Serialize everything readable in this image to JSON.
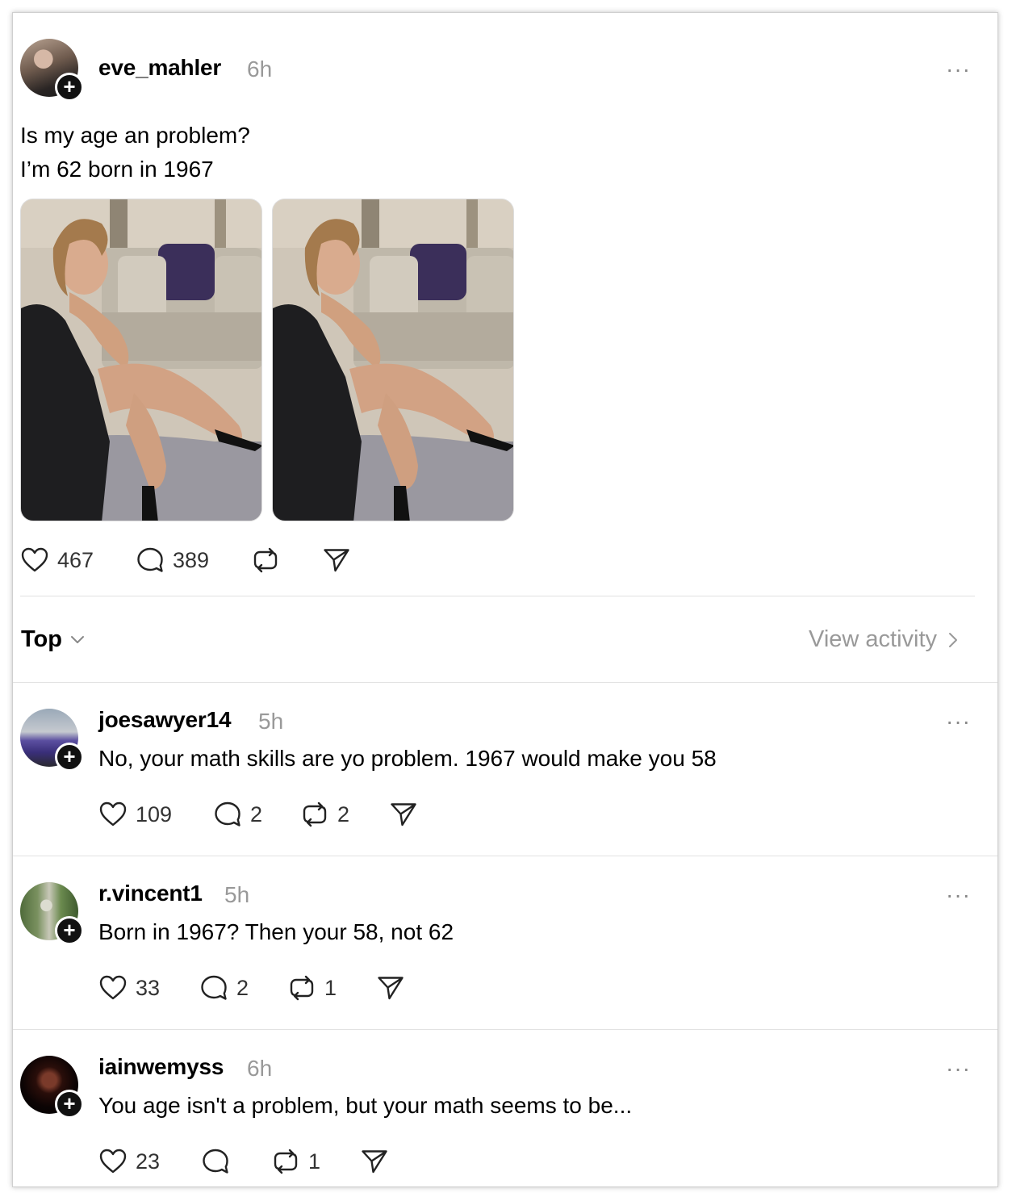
{
  "post": {
    "username": "eve_mahler",
    "time": "6h",
    "text_lines": [
      "Is my age an problem?",
      "I’m 62 born in 1967"
    ],
    "likes": "467",
    "replies": "389",
    "more": "···"
  },
  "replies_header": {
    "sort_label": "Top",
    "view_activity": "View activity"
  },
  "comments": [
    {
      "username": "joesawyer14",
      "time": "5h",
      "text": "No, your math skills are yo problem. 1967 would make you 58",
      "likes": "109",
      "replies": "2",
      "reposts": "2"
    },
    {
      "username": "r.vincent1",
      "time": "5h",
      "text": "Born in 1967? Then your 58, not 62",
      "likes": "33",
      "replies": "2",
      "reposts": "1"
    },
    {
      "username": "iainwemyss",
      "time": "6h",
      "text": "You age isn't a problem, but your math seems to be...",
      "likes": "23",
      "replies": "",
      "reposts": "1"
    }
  ],
  "icons": {
    "like": "heart-icon",
    "reply": "comment-icon",
    "repost": "repost-icon",
    "share": "send-icon",
    "more": "more-dots-icon",
    "follow": "plus-icon",
    "chevron": "chevron-icon"
  },
  "colors": {
    "text": "#000000",
    "muted": "#999999",
    "badge": "#111111",
    "divider": "#e2e2e2"
  }
}
